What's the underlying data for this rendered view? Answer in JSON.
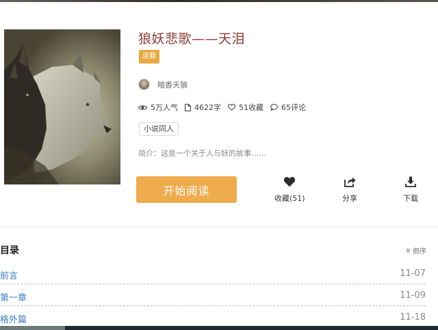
{
  "book": {
    "title": "狼妖悲歌——天泪",
    "status": "连载",
    "author": "暗香天狼",
    "stats": {
      "popularity": "5万人气",
      "words": "4622字",
      "favorites": "51收藏",
      "comments": "65评论"
    },
    "tag": "小说同人",
    "intro": "简介：这是一个关于人与妖的故事……"
  },
  "actions": {
    "read_label": "开始阅读",
    "favorite_label": "收藏(51)",
    "share_label": "分享",
    "download_label": "下载"
  },
  "toc": {
    "title": "目录",
    "sort_label": "倒序",
    "chapters": [
      {
        "name": "前言",
        "date": "11-07"
      },
      {
        "name": "第一章",
        "date": "11-09"
      },
      {
        "name": "格外篇",
        "date": "11-18"
      }
    ]
  },
  "colors": {
    "title": "#8b3b36",
    "accent": "#efac4c",
    "badge": "#e8a93f",
    "link": "#3d7cc0"
  },
  "icons": [
    "eye-icon",
    "document-icon",
    "heart-outline-icon",
    "comment-icon",
    "heart-icon",
    "share-icon",
    "download-icon",
    "chevron-down-icon"
  ]
}
